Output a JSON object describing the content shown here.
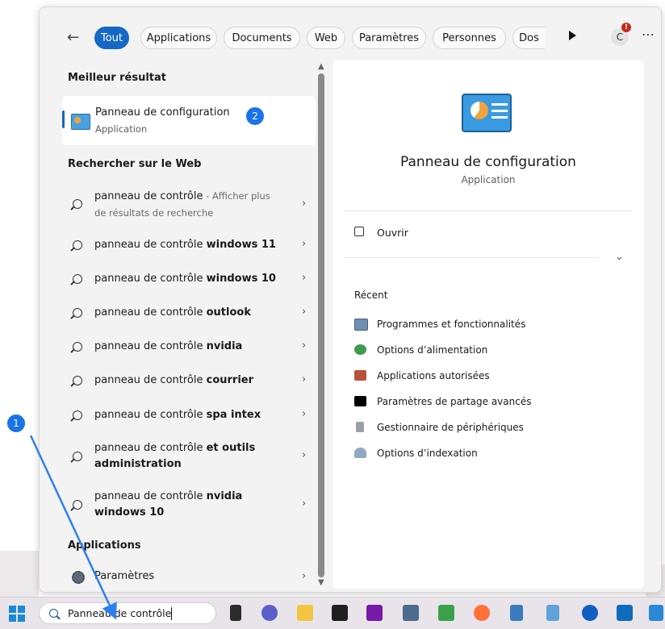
{
  "tabs": [
    {
      "label": "Tout",
      "active": true
    },
    {
      "label": "Applications"
    },
    {
      "label": "Documents"
    },
    {
      "label": "Web"
    },
    {
      "label": "Paramètres"
    },
    {
      "label": "Personnes"
    },
    {
      "label": "Dos"
    }
  ],
  "avatar": {
    "letter": "C",
    "alert": "!"
  },
  "left": {
    "best_section": "Meilleur résultat",
    "best": {
      "title": "Panneau de configuration",
      "subtitle": "Application"
    },
    "web_section": "Rechercher sur le Web",
    "web_items": [
      {
        "prefix": "panneau de contrôle",
        "bold": "",
        "hint": " - Afficher plus",
        "line2": "de résultats de recherche"
      },
      {
        "prefix": "panneau de contrôle ",
        "bold": "windows 11"
      },
      {
        "prefix": "panneau de contrôle ",
        "bold": "windows 10"
      },
      {
        "prefix": "panneau de contrôle ",
        "bold": "outlook"
      },
      {
        "prefix": "panneau de contrôle ",
        "bold": "nvidia"
      },
      {
        "prefix": "panneau de contrôle ",
        "bold": "courrier"
      },
      {
        "prefix": "panneau de contrôle ",
        "bold": "spa intex"
      },
      {
        "prefix": "panneau de contrôle ",
        "bold": "et outils",
        "line2": "administration"
      },
      {
        "prefix": "panneau de contrôle ",
        "bold": "nvidia",
        "line2": "windows 10"
      }
    ],
    "apps_section": "Applications",
    "app_item": "Paramètres"
  },
  "right": {
    "title": "Panneau de configuration",
    "subtitle": "Application",
    "open_label": "Ouvrir",
    "recent_title": "Récent",
    "recent_items": [
      "Programmes et fonctionnalités",
      "Options d’alimentation",
      "Applications autorisées",
      "Paramètres de partage avancés",
      "Gestionnaire de périphériques",
      "Options d’indexation"
    ]
  },
  "taskbar": {
    "search_text": "Panneau de contrôle"
  },
  "annotations": {
    "badge1": "1",
    "badge2": "2"
  },
  "colors": {
    "accent": "#1668c5",
    "badge": "#1a73e8"
  }
}
